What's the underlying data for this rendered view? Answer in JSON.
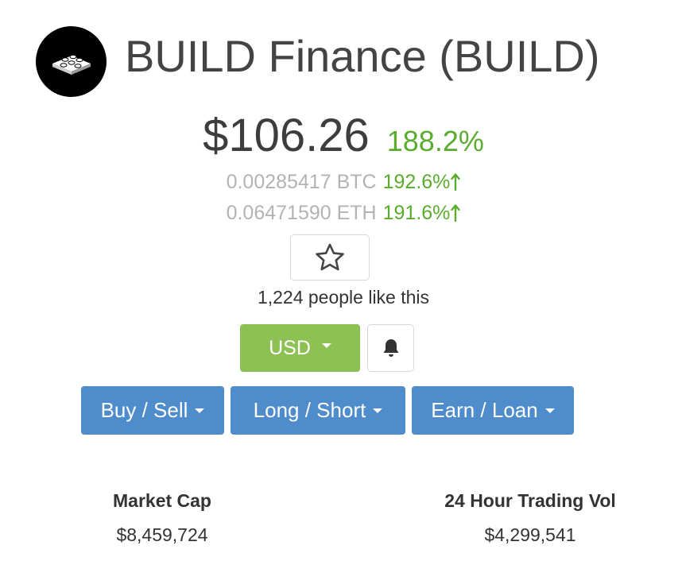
{
  "coin": {
    "title": "BUILD Finance (BUILD)",
    "logo_icon": "lego-brick-icon"
  },
  "price": {
    "value": "$106.26",
    "change": "188.2%"
  },
  "conversions": {
    "btc_value": "0.00285417 BTC",
    "btc_change": "192.6%",
    "eth_value": "0.06471590 ETH",
    "eth_change": "191.6%",
    "trend_icon": "arrow-up-icon"
  },
  "favorite": {
    "icon": "star-icon",
    "likes_text": "1,224 people like this"
  },
  "currency": {
    "selected": "USD"
  },
  "alert": {
    "icon": "bell-icon"
  },
  "actions": {
    "buy_sell": "Buy / Sell",
    "long_short": "Long / Short",
    "earn_loan": "Earn / Loan"
  },
  "stats": {
    "market_cap_label": "Market Cap",
    "market_cap_value": "$8,459,724",
    "volume_label": "24 Hour Trading Vol",
    "volume_value": "$4,299,541"
  },
  "colors": {
    "positive": "#5aac2e",
    "currency_button": "#8dc153",
    "action_button": "#4f8ccb",
    "muted_text": "#b3b3b3"
  }
}
